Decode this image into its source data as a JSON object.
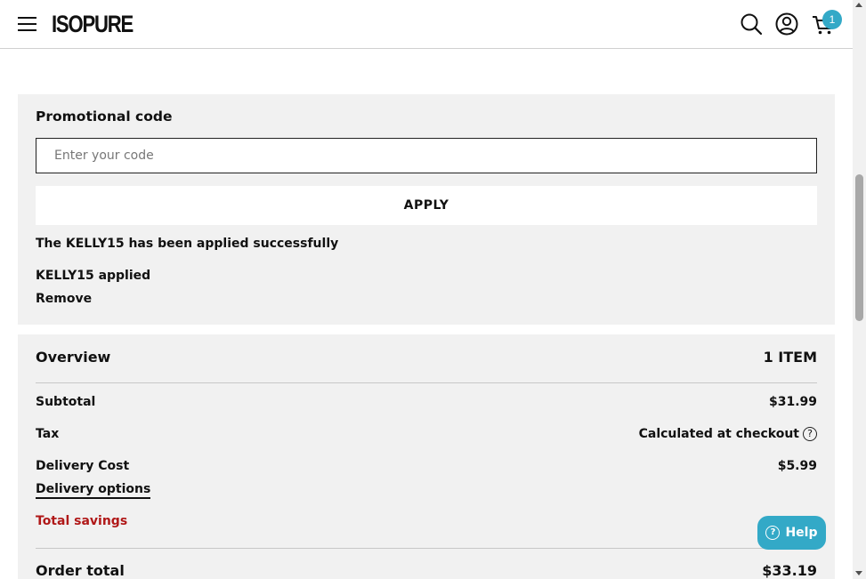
{
  "header": {
    "logo": "ISOPURE",
    "cart_count": "1"
  },
  "promo": {
    "title": "Promotional code",
    "input_placeholder": "Enter your code",
    "input_value": "",
    "apply_label": "APPLY",
    "success_message": "The KELLY15 has been applied successfully",
    "applied_text": "KELLY15 applied",
    "remove_label": "Remove"
  },
  "overview": {
    "title": "Overview",
    "item_count": "1 ITEM",
    "subtotal_label": "Subtotal",
    "subtotal_value": "$31.99",
    "tax_label": "Tax",
    "tax_value": "Calculated at checkout",
    "delivery_label": "Delivery Cost",
    "delivery_value": "$5.99",
    "delivery_options_label": "Delivery options",
    "savings_label": "Total savings",
    "order_total_label": "Order total",
    "order_total_value": "$33.19"
  },
  "help_button": {
    "label": "Help"
  },
  "icons": {
    "menu": "hamburger-icon",
    "search": "search-icon",
    "account": "account-icon",
    "cart": "cart-icon",
    "help": "question-circle-icon"
  },
  "colors": {
    "accent": "#33a9c7",
    "panel_bg": "#f1f1f1",
    "savings_text": "#b01818",
    "text": "#111111"
  }
}
